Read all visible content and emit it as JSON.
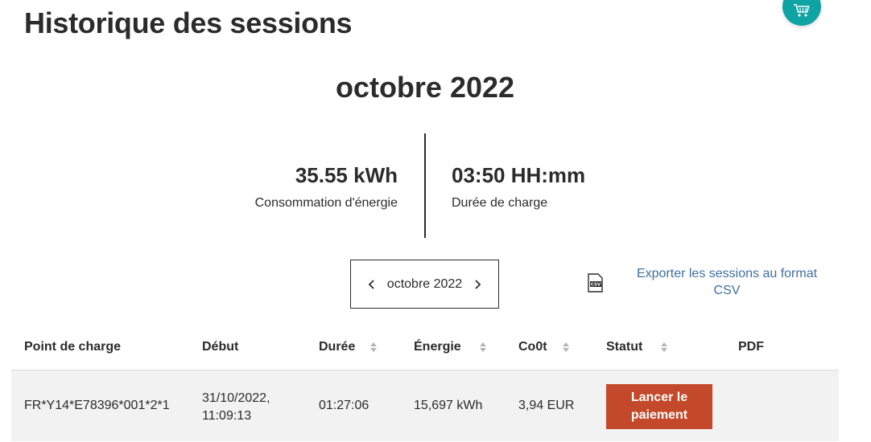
{
  "page": {
    "title": "Historique des sessions",
    "month_heading": "octobre 2022"
  },
  "cart": {
    "icon": "cart-icon",
    "color": "#0fa3a3"
  },
  "summary": {
    "energy_value": "35.55 kWh",
    "energy_label": "Consommation d'énergie",
    "duration_value": "03:50 HH:mm",
    "duration_label": "Durée de charge"
  },
  "month_picker": {
    "label": "octobre 2022",
    "prev_icon": "chevron-left-icon",
    "next_icon": "chevron-right-icon"
  },
  "export": {
    "icon": "csv-file-icon",
    "label": "Exporter les sessions au format CSV",
    "link_color": "#3e6fa3"
  },
  "table": {
    "columns": [
      "Point de charge",
      "Début",
      "Durée",
      "Énergie",
      "Co0t",
      "Statut",
      "PDF"
    ],
    "rows": [
      {
        "point": "FR*Y14*E78396*001*2*1",
        "start_date": "31/10/2022,",
        "start_time": "11:09:13",
        "duration": "01:27:06",
        "energy": "15,697 kWh",
        "cost": "3,94 EUR",
        "action": "Lancer le paiement"
      }
    ]
  },
  "colors": {
    "pay_button": "#c4492a",
    "row_bg": "#f2f2f2"
  }
}
